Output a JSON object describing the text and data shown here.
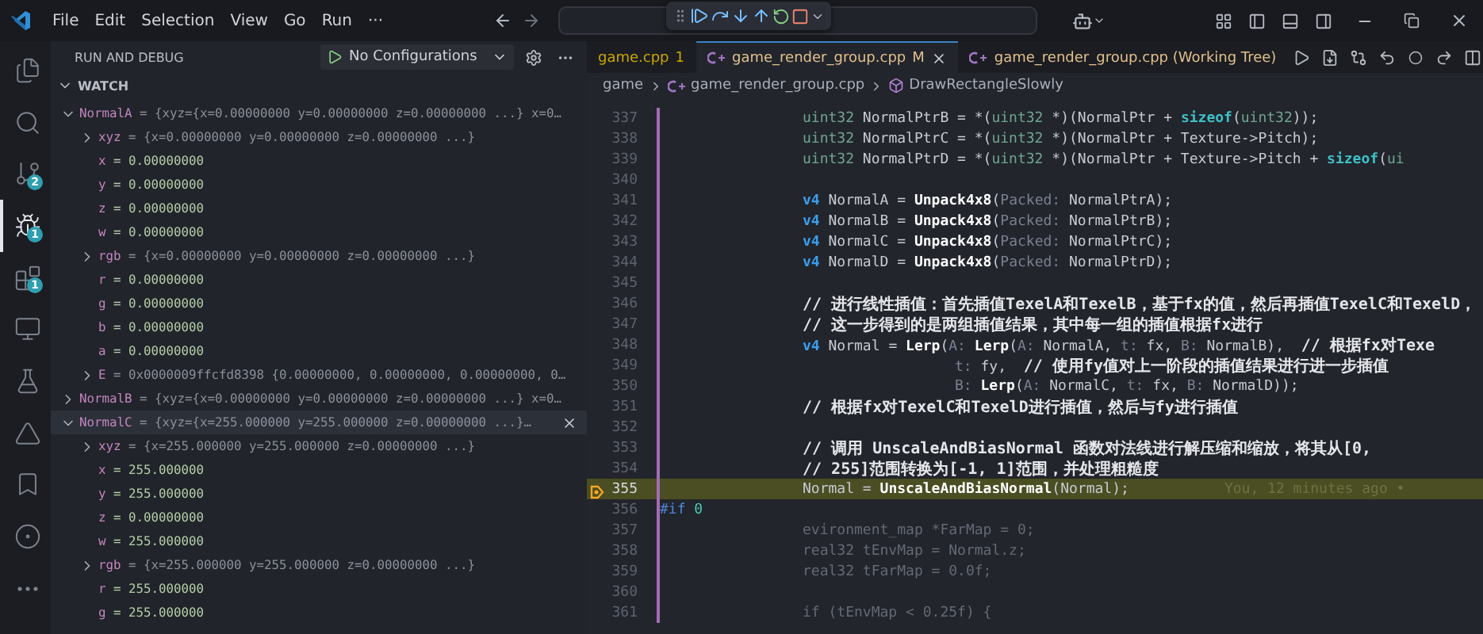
{
  "title_bar": {
    "menus": [
      "File",
      "Edit",
      "Selection",
      "View",
      "Go",
      "Run"
    ],
    "more": "···"
  },
  "activity_bar": [
    {
      "kind": "explorer",
      "selected": false
    },
    {
      "kind": "search",
      "selected": false
    },
    {
      "kind": "source-control",
      "selected": false,
      "badge": "2"
    },
    {
      "kind": "run-debug",
      "selected": true,
      "badge": "1"
    },
    {
      "kind": "extensions",
      "selected": false,
      "badge": "1"
    },
    {
      "kind": "remote",
      "selected": false
    },
    {
      "kind": "testing",
      "selected": false
    },
    {
      "kind": "azure",
      "selected": false
    },
    {
      "kind": "bookmarks",
      "selected": false
    },
    {
      "kind": "gitlens",
      "selected": false
    },
    {
      "kind": "more",
      "selected": false
    }
  ],
  "sidebar": {
    "title": "RUN AND DEBUG",
    "configuration": "No Configurations",
    "section": "WATCH",
    "watch": [
      {
        "name": "NormalA",
        "value": "= {xyz={x=0.00000000 y=0.00000000 z=0.00000000 ...} x=0…",
        "expanded": true,
        "selected": false,
        "children": [
          {
            "name": "xyz",
            "value": "= {x=0.00000000 y=0.00000000 z=0.00000000 ...}",
            "expanded": false,
            "selected": false
          },
          {
            "name": "x",
            "value": "= 0.00000000",
            "selected": false
          },
          {
            "name": "y",
            "value": "= 0.00000000",
            "selected": false
          },
          {
            "name": "z",
            "value": "= 0.00000000",
            "selected": false
          },
          {
            "name": "w",
            "value": "= 0.00000000",
            "selected": false
          },
          {
            "name": "rgb",
            "value": "= {x=0.00000000 y=0.00000000 z=0.00000000 ...}",
            "expanded": false,
            "selected": false
          },
          {
            "name": "r",
            "value": "= 0.00000000",
            "selected": false
          },
          {
            "name": "g",
            "value": "= 0.00000000",
            "selected": false
          },
          {
            "name": "b",
            "value": "= 0.00000000",
            "selected": false
          },
          {
            "name": "a",
            "value": "= 0.00000000",
            "selected": false
          },
          {
            "name": "E",
            "value": "= 0x0000009ffcfd8398 {0.00000000, 0.00000000, 0.00000000, 0…",
            "expanded": false,
            "selected": false
          }
        ]
      },
      {
        "name": "NormalB",
        "value": "= {xyz={x=0.00000000 y=0.00000000 z=0.00000000 ...} x=0…",
        "expanded": false,
        "selected": false
      },
      {
        "name": "NormalC",
        "value": "= {xyz={x=255.000000 y=255.000000 z=0.00000000 ...}…",
        "expanded": true,
        "selected": true,
        "children": [
          {
            "name": "xyz",
            "value": "= {x=255.000000 y=255.000000 z=0.00000000 ...}",
            "expanded": false,
            "selected": false
          },
          {
            "name": "x",
            "value": "= 255.000000",
            "selected": false
          },
          {
            "name": "y",
            "value": "= 255.000000",
            "selected": false
          },
          {
            "name": "z",
            "value": "= 0.00000000",
            "selected": false
          },
          {
            "name": "w",
            "value": "= 255.000000",
            "selected": false
          },
          {
            "name": "rgb",
            "value": "= {x=255.000000 y=255.000000 z=0.00000000 ...}",
            "expanded": false,
            "selected": false
          },
          {
            "name": "r",
            "value": "= 255.000000",
            "selected": false
          },
          {
            "name": "g",
            "value": "= 255.000000",
            "selected": false
          }
        ]
      }
    ]
  },
  "tabs": [
    {
      "label": "game.cpp",
      "badge": "1",
      "kind": "problem",
      "file_icon": false,
      "selected": false
    },
    {
      "label": "game_render_group.cpp",
      "badge": "M",
      "kind": "modified",
      "file_icon": true,
      "selected": true
    },
    {
      "label": "game_render_group.cpp (Working Tree)",
      "kind": "modified",
      "file_icon": true,
      "selected": false
    }
  ],
  "breadcrumb": [
    {
      "kind": "folder",
      "label": "game"
    },
    {
      "kind": "file",
      "label": "game_render_group.cpp"
    },
    {
      "kind": "symbol",
      "label": "DrawRectangleSlowly"
    }
  ],
  "code": [
    {
      "number": "337",
      "kind": "body",
      "tokens": [
        {
          "kind": "type",
          "text": "uint32"
        },
        {
          "kind": "id",
          "text": " NormalPtrB = *("
        },
        {
          "kind": "type",
          "text": "uint32"
        },
        {
          "kind": "id",
          "text": " *)(NormalPtr + "
        },
        {
          "kind": "op",
          "text": "sizeof"
        },
        {
          "kind": "id",
          "text": "("
        },
        {
          "kind": "type",
          "text": "uint32"
        },
        {
          "kind": "id",
          "text": "));"
        }
      ]
    },
    {
      "number": "338",
      "kind": "body",
      "tokens": [
        {
          "kind": "type",
          "text": "uint32"
        },
        {
          "kind": "id",
          "text": " NormalPtrC = *("
        },
        {
          "kind": "type",
          "text": "uint32"
        },
        {
          "kind": "id",
          "text": " *)(NormalPtr + Texture->Pitch);"
        }
      ]
    },
    {
      "number": "339",
      "kind": "body",
      "tokens": [
        {
          "kind": "type",
          "text": "uint32"
        },
        {
          "kind": "id",
          "text": " NormalPtrD = *("
        },
        {
          "kind": "type",
          "text": "uint32"
        },
        {
          "kind": "id",
          "text": " *)(NormalPtr + Texture->Pitch + "
        },
        {
          "kind": "op",
          "text": "sizeof"
        },
        {
          "kind": "id",
          "text": "("
        },
        {
          "kind": "type",
          "text": "ui"
        }
      ]
    },
    {
      "number": "340",
      "kind": "blank"
    },
    {
      "number": "341",
      "kind": "body",
      "tokens": [
        {
          "kind": "kw",
          "text": "v4"
        },
        {
          "kind": "id",
          "text": " NormalA = "
        },
        {
          "kind": "fn",
          "text": "Unpack4x8"
        },
        {
          "kind": "id",
          "text": "("
        },
        {
          "kind": "hint",
          "text": "Packed:"
        },
        {
          "kind": "id",
          "text": " NormalPtrA);"
        }
      ]
    },
    {
      "number": "342",
      "kind": "body",
      "tokens": [
        {
          "kind": "kw",
          "text": "v4"
        },
        {
          "kind": "id",
          "text": " NormalB = "
        },
        {
          "kind": "fn",
          "text": "Unpack4x8"
        },
        {
          "kind": "id",
          "text": "("
        },
        {
          "kind": "hint",
          "text": "Packed:"
        },
        {
          "kind": "id",
          "text": " NormalPtrB);"
        }
      ]
    },
    {
      "number": "343",
      "kind": "body",
      "tokens": [
        {
          "kind": "kw",
          "text": "v4"
        },
        {
          "kind": "id",
          "text": " NormalC = "
        },
        {
          "kind": "fn",
          "text": "Unpack4x8"
        },
        {
          "kind": "id",
          "text": "("
        },
        {
          "kind": "hint",
          "text": "Packed:"
        },
        {
          "kind": "id",
          "text": " NormalPtrC);"
        }
      ]
    },
    {
      "number": "344",
      "kind": "body",
      "tokens": [
        {
          "kind": "kw",
          "text": "v4"
        },
        {
          "kind": "id",
          "text": " NormalD = "
        },
        {
          "kind": "fn",
          "text": "Unpack4x8"
        },
        {
          "kind": "id",
          "text": "("
        },
        {
          "kind": "hint",
          "text": "Packed:"
        },
        {
          "kind": "id",
          "text": " NormalPtrD);"
        }
      ]
    },
    {
      "number": "345",
      "kind": "blank"
    },
    {
      "number": "346",
      "kind": "body",
      "tokens": [
        {
          "kind": "cm",
          "text": "// 进行线性插值：首先插值TexelA和TexelB，基于fx的值，然后再插值TexelC和TexelD，"
        }
      ]
    },
    {
      "number": "347",
      "kind": "body",
      "tokens": [
        {
          "kind": "cm",
          "text": "// 这一步得到的是两组插值结果，其中每一组的插值根据fx进行"
        }
      ]
    },
    {
      "number": "348",
      "kind": "body",
      "tokens": [
        {
          "kind": "kw",
          "text": "v4"
        },
        {
          "kind": "id",
          "text": " Normal = "
        },
        {
          "kind": "fn",
          "text": "Lerp"
        },
        {
          "kind": "id",
          "text": "("
        },
        {
          "kind": "hint",
          "text": "A:"
        },
        {
          "kind": "fn",
          "text": " Lerp"
        },
        {
          "kind": "id",
          "text": "("
        },
        {
          "kind": "hint",
          "text": "A:"
        },
        {
          "kind": "id",
          "text": " NormalA, "
        },
        {
          "kind": "hint",
          "text": "t:"
        },
        {
          "kind": "id",
          "text": " fx, "
        },
        {
          "kind": "hint",
          "text": "B:"
        },
        {
          "kind": "id",
          "text": " NormalB),  "
        },
        {
          "kind": "cm",
          "text": "// 根据fx对Texe"
        }
      ]
    },
    {
      "number": "349",
      "kind": "continuation",
      "tokens": [
        {
          "kind": "hint",
          "text": "t:"
        },
        {
          "kind": "id",
          "text": " fy,  "
        },
        {
          "kind": "cm",
          "text": "// 使用fy值对上一阶段的插值结果进行进一步插值"
        }
      ]
    },
    {
      "number": "350",
      "kind": "continuation",
      "tokens": [
        {
          "kind": "hint",
          "text": "B:"
        },
        {
          "kind": "fn",
          "text": " Lerp"
        },
        {
          "kind": "id",
          "text": "("
        },
        {
          "kind": "hint",
          "text": "A:"
        },
        {
          "kind": "id",
          "text": " NormalC, "
        },
        {
          "kind": "hint",
          "text": "t:"
        },
        {
          "kind": "id",
          "text": " fx, "
        },
        {
          "kind": "hint",
          "text": "B:"
        },
        {
          "kind": "id",
          "text": " NormalD));"
        }
      ]
    },
    {
      "number": "351",
      "kind": "body",
      "tokens": [
        {
          "kind": "cm",
          "text": "// 根据fx对TexelC和TexelD进行插值，然后与fy进行插值"
        }
      ]
    },
    {
      "number": "352",
      "kind": "blank"
    },
    {
      "number": "353",
      "kind": "body",
      "tokens": [
        {
          "kind": "cm",
          "text": "// 调用 UnscaleAndBiasNormal 函数对法线进行解压缩和缩放，将其从[0,"
        }
      ]
    },
    {
      "number": "354",
      "kind": "body",
      "tokens": [
        {
          "kind": "cm",
          "text": "// 255]范围转换为[-1, 1]范围，并处理粗糙度"
        }
      ]
    },
    {
      "number": "355",
      "kind": "body",
      "current": true,
      "blame": "You, 12 minutes ago •",
      "tokens": [
        {
          "kind": "id",
          "text": "Normal = "
        },
        {
          "kind": "fn",
          "text": "UnscaleAndBiasNormal"
        },
        {
          "kind": "id",
          "text": "(Normal);"
        }
      ]
    },
    {
      "number": "356",
      "kind": "top",
      "tokens": [
        {
          "kind": "pp",
          "text": "#if"
        },
        {
          "kind": "num",
          "text": " 0"
        }
      ]
    },
    {
      "number": "357",
      "kind": "body",
      "tokens": [
        {
          "kind": "dim",
          "text": "evironment_map *FarMap = 0;"
        }
      ]
    },
    {
      "number": "358",
      "kind": "body",
      "tokens": [
        {
          "kind": "dim",
          "text": "real32 tEnvMap = Normal.z;"
        }
      ]
    },
    {
      "number": "359",
      "kind": "body",
      "tokens": [
        {
          "kind": "dim",
          "text": "real32 tFarMap = 0.0f;"
        }
      ]
    },
    {
      "number": "360",
      "kind": "blank"
    },
    {
      "number": "361",
      "kind": "body",
      "tokens": [
        {
          "kind": "dim",
          "text": "if (tEnvMap < 0.25f) {"
        }
      ]
    }
  ]
}
